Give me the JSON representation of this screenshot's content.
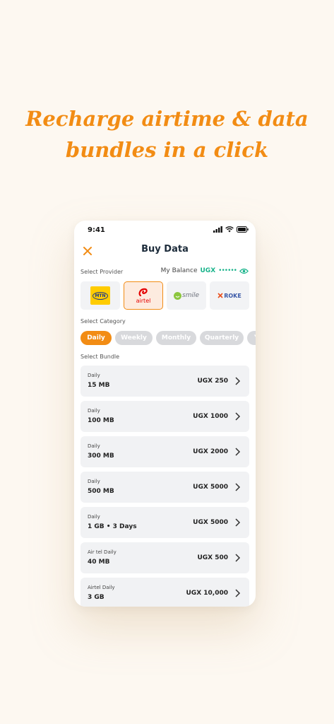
{
  "headline": {
    "line1": "Recharge airtime & data",
    "line2": "bundles in a click"
  },
  "status_bar": {
    "time": "9:41"
  },
  "app_bar": {
    "title": "Buy Data"
  },
  "provider_section": {
    "label": "Select Provider",
    "balance_label": "My Balance",
    "balance_currency": "UGX",
    "balance_masked": "••••••",
    "providers": [
      {
        "name": "MTN",
        "text": "MTN",
        "selected": false
      },
      {
        "name": "airtel",
        "text": "airtel",
        "selected": true
      },
      {
        "name": "smile",
        "text": "smile",
        "selected": false
      },
      {
        "name": "ROKE",
        "text": "ROKE",
        "selected": false
      }
    ]
  },
  "category_section": {
    "label": "Select Category",
    "chips": [
      {
        "label": "Daily",
        "active": true
      },
      {
        "label": "Weekly",
        "active": false
      },
      {
        "label": "Monthly",
        "active": false
      },
      {
        "label": "Quarterly",
        "active": false
      },
      {
        "label": "Y",
        "active": false
      }
    ]
  },
  "bundle_section": {
    "label": "Select Bundle",
    "bundles": [
      {
        "category": "Daily",
        "name": "15 MB",
        "price": "UGX 250"
      },
      {
        "category": "Daily",
        "name": "100 MB",
        "price": "UGX 1000"
      },
      {
        "category": "Daily",
        "name": "300 MB",
        "price": "UGX 2000"
      },
      {
        "category": "Daily",
        "name": "500 MB",
        "price": "UGX 5000"
      },
      {
        "category": "Daily",
        "name": "1 GB • 3 Days",
        "price": "UGX 5000"
      },
      {
        "category": "Air tel Daily",
        "name": "40 MB",
        "price": "UGX 500"
      },
      {
        "category": "Airtel Daily",
        "name": "3 GB",
        "price": "UGX 10,000"
      }
    ]
  },
  "colors": {
    "accent": "#f28c14",
    "balance": "#17b38a",
    "title": "#1c2b3a"
  }
}
